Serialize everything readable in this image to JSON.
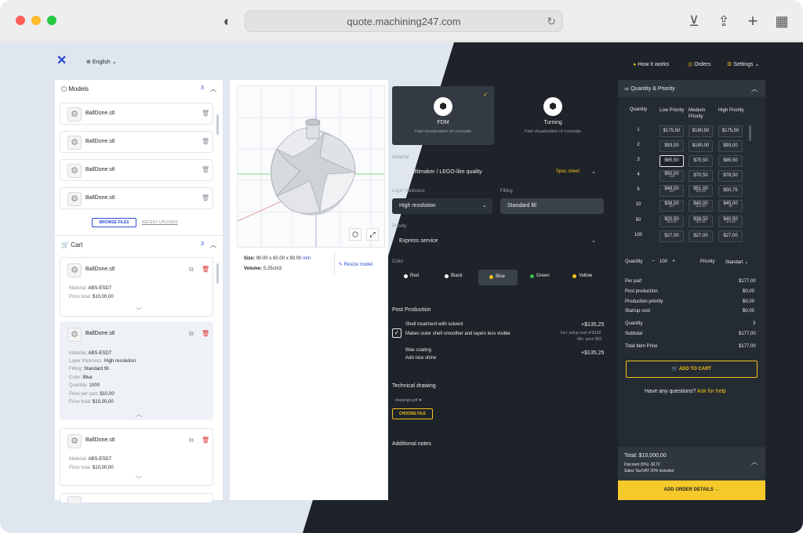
{
  "browser": {
    "url": "quote.machining247.com"
  },
  "header": {
    "language": "English",
    "how_it_works": "How it works",
    "orders": "Orders",
    "settings": "Settings"
  },
  "models": {
    "title": "Models",
    "count": "3",
    "items": [
      "BallDone.stl",
      "BallDone.stl",
      "BallDone.stl",
      "BallDone.stl"
    ],
    "browse": "BROWSE FILES",
    "recent": "RECENT UPLOADS"
  },
  "cart": {
    "title": "Cart",
    "count": "3",
    "item1": {
      "name": "BallDone.stl",
      "material_label": "Material:",
      "material": "ABS-ESD7",
      "price_label": "Price total:",
      "price": "$10,00,00"
    },
    "item2": {
      "name": "BallDone.stl",
      "rows": [
        {
          "label": "Material:",
          "value": "ABS-ESD7"
        },
        {
          "label": "Layer thickness:",
          "value": "High resolution"
        },
        {
          "label": "Filling:",
          "value": "Standard fill"
        },
        {
          "label": "Color:",
          "value": "Blue"
        },
        {
          "label": "Quantity:",
          "value": "1000"
        },
        {
          "label": "Price per part:",
          "value": "$10,00"
        },
        {
          "label": "Price total:",
          "value": "$10,00,00"
        }
      ]
    },
    "item3": {
      "name": "BallDone.stl",
      "material_label": "Material:",
      "material": "ABS-ESD7",
      "price_label": "Price total:",
      "price": "$10,00,00"
    }
  },
  "viewer": {
    "size_label": "Size:",
    "size": "90.00 x 60.00 x 90.00",
    "unit": "mm",
    "volume_label": "Volume:",
    "volume": "5.25cm3",
    "resize": "Resize model"
  },
  "process": {
    "fdm": {
      "title": "FDM",
      "desc": "Fast visualization of concepts"
    },
    "turning": {
      "title": "Turning",
      "desc": "Fast visualization of concepts"
    }
  },
  "config": {
    "material_label": "Material",
    "material": "ABS Ultimaker / LEGO-like quality",
    "spec_sheet": "Spec sheet",
    "layer_label": "Layer thickness",
    "layer": "High resolution",
    "filling_label": "Filling",
    "filling": "Standard fill",
    "priority_label": "Priority",
    "priority": "Express service",
    "color_label": "Color",
    "colors": [
      {
        "name": "Red",
        "hex": "#ffffff"
      },
      {
        "name": "Black",
        "hex": "#ffffff"
      },
      {
        "name": "Blue",
        "hex": "#f2c21b"
      },
      {
        "name": "Green",
        "hex": "#3fbf4a"
      },
      {
        "name": "Yellow",
        "hex": "#f2c21b"
      }
    ]
  },
  "post": {
    "title": "Post Production",
    "shell_title": "Shell treatment with solvent",
    "shell_desc": "Makes outer shell smoother and layers less visible",
    "shell_price": "+$135,25",
    "shell_note1": "Incl. setup cost of $100",
    "shell_note2": "Min. price $50",
    "wax": "Wax coating",
    "shine": "Add nice shine",
    "wax_price": "+$135,25"
  },
  "drawing": {
    "title": "Technical drawing",
    "file": "drawings.pdf",
    "choose": "CHOOSE FILE"
  },
  "notes": {
    "title": "Additional notes"
  },
  "qp": {
    "title": "Quantity & Priority",
    "headers": [
      "Quantity",
      "Low Priority",
      "Medium Priority",
      "High Priority"
    ],
    "rows": [
      {
        "q": "1",
        "c": [
          "$175,50",
          "$180,50",
          "$175,50"
        ],
        "s": [
          "",
          "",
          ""
        ]
      },
      {
        "q": "2",
        "c": [
          "$93,00",
          "$180,00",
          "$93,00"
        ],
        "s": [
          "",
          "",
          ""
        ]
      },
      {
        "q": "3",
        "c": [
          "$65,50",
          "$75,50",
          "$85,50"
        ],
        "s": [
          "",
          "",
          ""
        ]
      },
      {
        "q": "4",
        "c": [
          "$50,50",
          "$70,50",
          "$78,50"
        ],
        "s": [
          "-$15",
          "",
          ""
        ]
      },
      {
        "q": "5",
        "c": [
          "$48,50",
          "$51,00",
          "$50,75"
        ],
        "s": [
          "-$17",
          "-$14,50",
          ""
        ]
      },
      {
        "q": "10",
        "c": [
          "$38,50",
          "$40,00",
          "$45,00"
        ],
        "s": [
          "-$27",
          "-$15,50",
          "-$9"
        ]
      },
      {
        "q": "50",
        "c": [
          "$20,50",
          "$38,50",
          "$40,50"
        ],
        "s": [
          "-$45,00",
          "-$37,50",
          "-$35,50"
        ]
      },
      {
        "q": "100",
        "c": [
          "$27,00",
          "$27,00",
          "$27,00"
        ],
        "s": [
          "",
          "",
          ""
        ]
      }
    ],
    "quantity_label": "Quantity",
    "quantity": "100",
    "priority_label": "Priority",
    "priority": "Standart"
  },
  "summary": {
    "rows": [
      {
        "label": "Per part",
        "value": "$177,00"
      },
      {
        "label": "Post production",
        "value": "$0,00"
      },
      {
        "label": "Production priority",
        "value": "$0,00"
      },
      {
        "label": "Startup cost",
        "value": "$0,00"
      },
      {
        "label": "Quantity",
        "value": "3"
      },
      {
        "label": "Subtotal",
        "value": "$177,00"
      }
    ],
    "total_label": "Total Item Price",
    "total": "$177,00",
    "add_to_cart": "ADD TO CART",
    "question": "Have any questions?",
    "ask": "Ask for help"
  },
  "footer": {
    "total": "Total: $10,000,00",
    "discount": "Discount (5%) -$172",
    "tax": "Sales Tax/VAT 20% included",
    "cta": "ADD ORDER DETAILS →"
  }
}
